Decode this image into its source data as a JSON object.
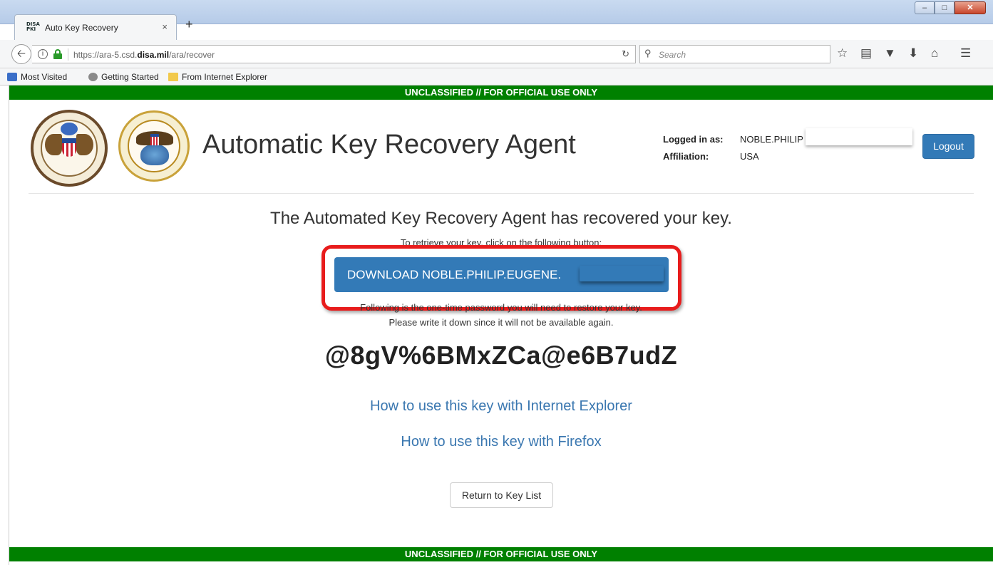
{
  "browser": {
    "tab_title": "Auto Key Recovery",
    "tab_favicon_text": "DISA PKI",
    "new_tab": "+",
    "tab_close": "×",
    "url_prefix": "https://ara-5.csd.",
    "url_domain": "disa.mil",
    "url_path": "/ara/recover",
    "search_placeholder": "Search",
    "window_buttons": {
      "minimize": "–",
      "maximize": "□",
      "close": "✕"
    },
    "bookmarks": [
      "Most Visited",
      "Getting Started",
      "From Internet Explorer"
    ]
  },
  "page": {
    "classification": "UNCLASSIFIED // FOR OFFICIAL USE ONLY",
    "app_title": "Automatic Key Recovery Agent",
    "login": {
      "logged_in_label": "Logged in as:",
      "logged_in_value": "NOBLE.PHILIP",
      "affiliation_label": "Affiliation:",
      "affiliation_value": "USA"
    },
    "logout_label": "Logout",
    "headline": "The Automated Key Recovery Agent has recovered your key.",
    "retrieve_instruction": "To retrieve your key, click on the following button:",
    "download_label": "DOWNLOAD NOBLE.PHILIP.EUGENE.",
    "otp_instruction_1": "Following is the one-time password you will need to restore your key.",
    "otp_instruction_2": "Please write it down since it will not be available again.",
    "otp": "@8gV%6BMxZCa@e6B7udZ",
    "link_ie": "How to use this key with Internet Explorer",
    "link_firefox": "How to use this key with Firefox",
    "return_label": "Return to Key List"
  },
  "colors": {
    "banner": "#008000",
    "primary": "#337ab7",
    "link": "#3a77b0",
    "highlight": "#e81c1c"
  }
}
